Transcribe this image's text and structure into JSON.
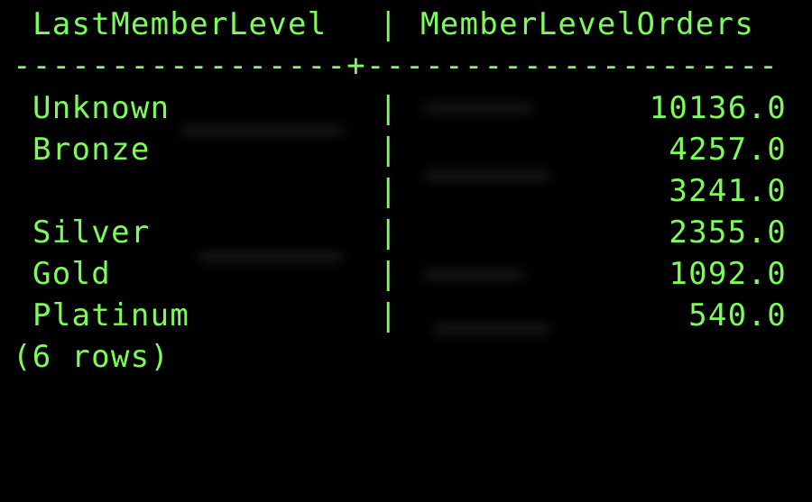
{
  "table": {
    "headers": [
      "LastMemberLevel",
      "MemberLevelOrders"
    ],
    "header_separator": "|",
    "divider_left": "-----------------",
    "divider_plus": "+",
    "divider_right": "---------------------",
    "rows": [
      {
        "level": "Unknown",
        "orders": "10136.0"
      },
      {
        "level": "Bronze",
        "orders": "4257.0"
      },
      {
        "level": "",
        "orders": "3241.0"
      },
      {
        "level": "Silver",
        "orders": "2355.0"
      },
      {
        "level": "Gold",
        "orders": "1092.0"
      },
      {
        "level": "Platinum",
        "orders": "540.0"
      }
    ],
    "row_separator": "|",
    "row_count": "(6 rows)"
  },
  "colors": {
    "text": "#7CFB5A",
    "background": "#000000"
  }
}
